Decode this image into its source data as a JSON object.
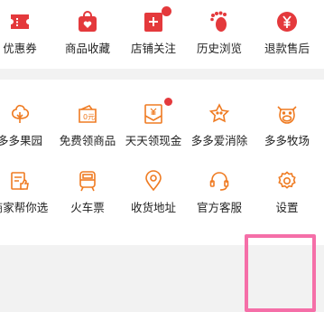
{
  "colors": {
    "accent": "#e4393c",
    "icon_orange": "#ef7b22",
    "highlight": "#f56fa8"
  },
  "top_row": [
    {
      "label": "优惠券",
      "icon": "coupon-icon"
    },
    {
      "label": "商品收藏",
      "icon": "bag-heart-icon"
    },
    {
      "label": "店铺关注",
      "icon": "store-plus-icon",
      "badge": true
    },
    {
      "label": "历史浏览",
      "icon": "footprint-icon"
    },
    {
      "label": "退款售后",
      "icon": "refund-yen-icon"
    }
  ],
  "service_rows": [
    [
      {
        "label": "多多果园",
        "icon": "tree-icon"
      },
      {
        "label": "免费领商品",
        "icon": "wallet-icon"
      },
      {
        "label": "天天领现金",
        "icon": "cash-envelope-icon",
        "badge": true
      },
      {
        "label": "多多爱消除",
        "icon": "star-icon"
      },
      {
        "label": "多多牧场",
        "icon": "cow-icon"
      }
    ],
    [
      {
        "label": "商家帮你选",
        "icon": "thumbs-up-icon"
      },
      {
        "label": "火车票",
        "icon": "train-icon"
      },
      {
        "label": "收货地址",
        "icon": "location-pin-icon"
      },
      {
        "label": "官方客服",
        "icon": "headset-icon"
      },
      {
        "label": "设置",
        "icon": "settings-gear-icon"
      }
    ]
  ]
}
